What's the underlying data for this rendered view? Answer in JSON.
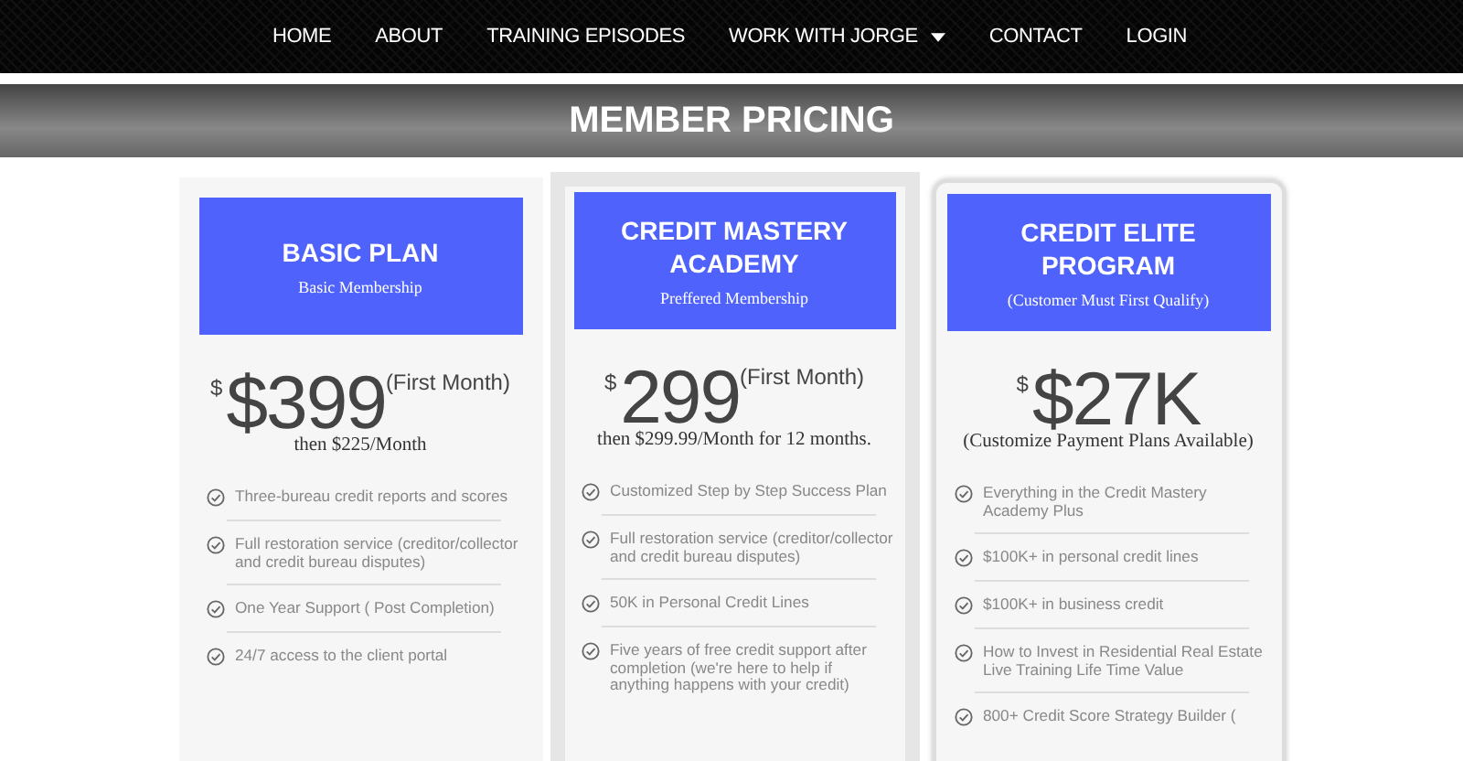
{
  "nav": {
    "items": [
      {
        "label": "HOME",
        "has_dropdown": false
      },
      {
        "label": "ABOUT",
        "has_dropdown": false
      },
      {
        "label": "TRAINING EPISODES",
        "has_dropdown": false
      },
      {
        "label": "WORK WITH JORGE",
        "has_dropdown": true
      },
      {
        "label": "CONTACT",
        "has_dropdown": false
      },
      {
        "label": "LOGIN",
        "has_dropdown": false
      }
    ]
  },
  "banner": {
    "title": "MEMBER PRICING"
  },
  "plans": [
    {
      "kind": "plain",
      "title": "BASIC PLAN",
      "subtitle": "Basic Membership",
      "currency": "$",
      "price": "$399",
      "price_note": "(First Month)",
      "terms": "then $225/Month",
      "features": [
        "Three-bureau credit reports and scores",
        "Full restoration service (creditor/collector and credit bureau disputes)",
        "One Year Support ( Post Completion)",
        "24/7 access to the client portal"
      ]
    },
    {
      "kind": "bordered",
      "title": "CREDIT MASTERY ACADEMY",
      "subtitle": "Preffered Membership",
      "currency": "$",
      "price": "299",
      "price_note": "(First Month)",
      "terms": "then $299.99/Month for 12 months.",
      "features": [
        "Customized Step by Step Success Plan",
        "Full restoration service (creditor/collector and credit bureau disputes)",
        "50K in Personal Credit Lines",
        "Five years of free credit support after completion (we're here to help if anything happens with your credit)"
      ]
    },
    {
      "kind": "raised",
      "title": "CREDIT ELITE PROGRAM",
      "subtitle": "(Customer Must First Qualify)",
      "currency": "$",
      "price": "$27K",
      "terms": "(Customize Payment Plans Available)",
      "features": [
        "Everything in the Credit Mastery Academy Plus",
        "$100K+ in personal credit lines",
        "$100K+ in business credit",
        "How to Invest in Residential Real Estate Live Training Life Time Value",
        "800+ Credit Score Strategy Builder ("
      ]
    }
  ]
}
